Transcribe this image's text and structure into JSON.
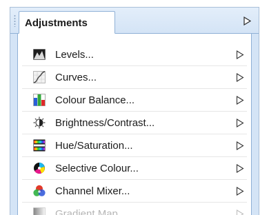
{
  "panel": {
    "tab_label": "Adjustments",
    "menu_icon": "triangle-right-icon"
  },
  "items": [
    {
      "label": "Levels...",
      "icon": "levels-icon",
      "enabled": true
    },
    {
      "label": "Curves...",
      "icon": "curves-icon",
      "enabled": true
    },
    {
      "label": "Colour Balance...",
      "icon": "colour-balance-icon",
      "enabled": true
    },
    {
      "label": "Brightness/Contrast...",
      "icon": "brightness-contrast-icon",
      "enabled": true
    },
    {
      "label": "Hue/Saturation...",
      "icon": "hue-saturation-icon",
      "enabled": true
    },
    {
      "label": "Selective Colour...",
      "icon": "selective-colour-icon",
      "enabled": true
    },
    {
      "label": "Channel Mixer...",
      "icon": "channel-mixer-icon",
      "enabled": true
    },
    {
      "label": "Gradient Map...",
      "icon": "gradient-map-icon",
      "enabled": false
    }
  ],
  "colors": {
    "panel_bg": "#d4e4f6",
    "border": "#8fb0d6",
    "text": "#1b1b1b",
    "disabled_text": "#7a7a7a"
  }
}
